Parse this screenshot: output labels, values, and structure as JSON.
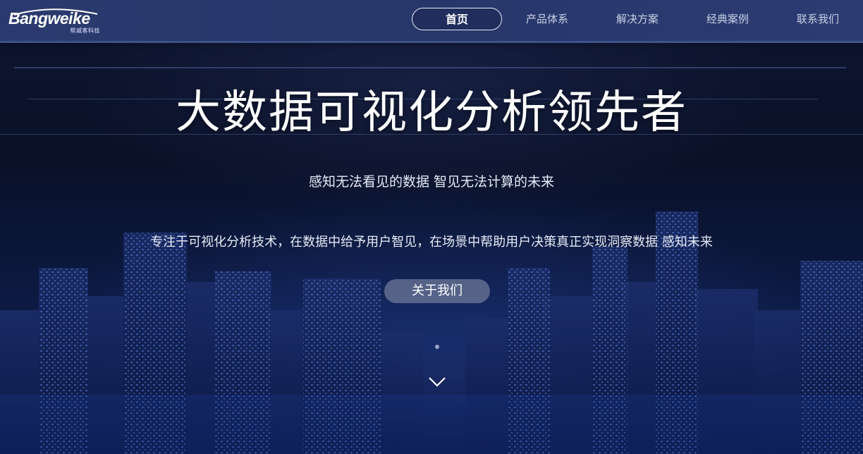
{
  "brand": {
    "logo_text": "Bangweike",
    "logo_subtext": "帮威客科技"
  },
  "nav": {
    "items": [
      {
        "label": "首页",
        "active": true
      },
      {
        "label": "产品体系",
        "active": false
      },
      {
        "label": "解决方案",
        "active": false
      },
      {
        "label": "经典案例",
        "active": false
      },
      {
        "label": "联系我们",
        "active": false
      }
    ]
  },
  "hero": {
    "title": "大数据可视化分析领先者",
    "subtitle": "感知无法看见的数据 智见无法计算的未来",
    "description": "专注于可视化分析技术，在数据中给予用户智见，在场景中帮助用户决策真正实现洞察数据 感知未来",
    "about_button": "关于我们"
  },
  "colors": {
    "header_bg": "#2b3a6e",
    "page_bg": "#0a1230",
    "nav_text": "#c9d0e6",
    "nav_active_border": "#e8ecf8",
    "button_bg": "#8c96af"
  },
  "icons": {
    "scroll_down": "chevron-down-icon"
  }
}
